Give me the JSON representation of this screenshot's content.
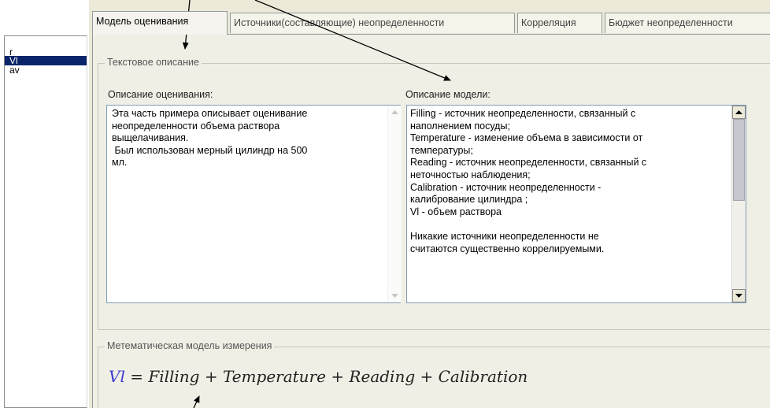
{
  "tabs": [
    {
      "label": "Модель оценивания",
      "active": true
    },
    {
      "label": "Источники(составляющие) неопределенности",
      "active": false
    },
    {
      "label": "Корреляция",
      "active": false
    },
    {
      "label": "Бюджет неопределенности",
      "active": false
    }
  ],
  "sidebar": {
    "items": [
      {
        "label": "r",
        "selected": false
      },
      {
        "label": "Vl",
        "selected": true
      },
      {
        "label": "av",
        "selected": false
      }
    ]
  },
  "text_description": {
    "group_label": "Текстовое описание",
    "evaluation": {
      "label": "Описание оценивания:",
      "text": "Эта часть примера описывает оценивание\nнеопределенности объема раствора\nвыщелачивания.\n Был использован мерный цилиндр на 500\nмл."
    },
    "model": {
      "label": "Описание модели:",
      "text": "Filling - источник неопределенности, связанный с\nнаполнением посуды;\nTemperature - изменение объема в зависимости от\nтемпературы;\nReading - источник неопределенности, связанный с\nнеточностью наблюдения;\nCalibration - источник неопределенности -\nкалибрование цилиндра ;\nVl - объем раствора\n\nНикакие источники неопределенности не\nсчитаются существенно коррелируемыми."
    }
  },
  "math_model": {
    "group_label": "Метематическая модель измерения",
    "lhs": "Vl",
    "rhs": "= Filling + Temperature + Reading + Calibration"
  },
  "colors": {
    "selection": "#0a246a",
    "formula_lhs": "#3a3ad0",
    "annotation_arrows": "#000000"
  }
}
